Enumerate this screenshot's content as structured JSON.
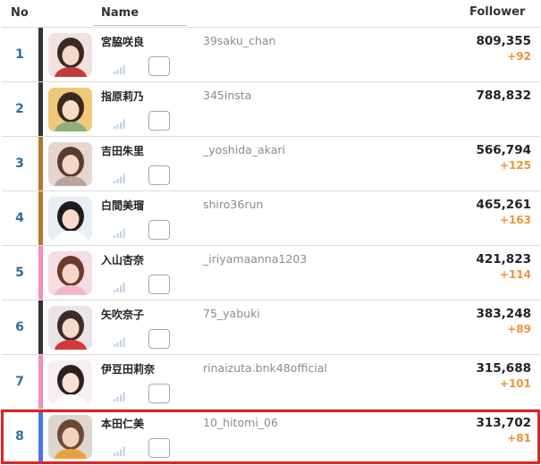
{
  "header": {
    "no": "No",
    "name": "Name",
    "follower": "Follower"
  },
  "colors": {
    "rank_text": "#2f6f9f",
    "delta": "#f0923a",
    "highlight": "#e02424"
  },
  "rows": [
    {
      "rank": "1",
      "name": "宮脇咲良",
      "handle": "39saku_chan",
      "followers": "809,355",
      "delta": "+92",
      "bar_color": "#333333"
    },
    {
      "rank": "2",
      "name": "指原莉乃",
      "handle": "345insta",
      "followers": "788,832",
      "delta": "",
      "bar_color": "#333333"
    },
    {
      "rank": "3",
      "name": "吉田朱里",
      "handle": "_yoshida_akari",
      "followers": "566,794",
      "delta": "+125",
      "bar_color": "#b07a2a"
    },
    {
      "rank": "4",
      "name": "白間美瑠",
      "handle": "shiro36run",
      "followers": "465,261",
      "delta": "+163",
      "bar_color": "#b07a2a"
    },
    {
      "rank": "5",
      "name": "入山杏奈",
      "handle": "_iriyamaanna1203",
      "followers": "421,823",
      "delta": "+114",
      "bar_color": "#f48fb8"
    },
    {
      "rank": "6",
      "name": "矢吹奈子",
      "handle": "75_yabuki",
      "followers": "383,248",
      "delta": "+89",
      "bar_color": "#333333"
    },
    {
      "rank": "7",
      "name": "伊豆田莉奈",
      "handle": "rinaizuta.bnk48official",
      "followers": "315,688",
      "delta": "+101",
      "bar_color": "#f48fb8"
    },
    {
      "rank": "8",
      "name": "本田仁美",
      "handle": "10_hitomi_06",
      "followers": "313,702",
      "delta": "+81",
      "bar_color": "#4a78e0"
    }
  ]
}
